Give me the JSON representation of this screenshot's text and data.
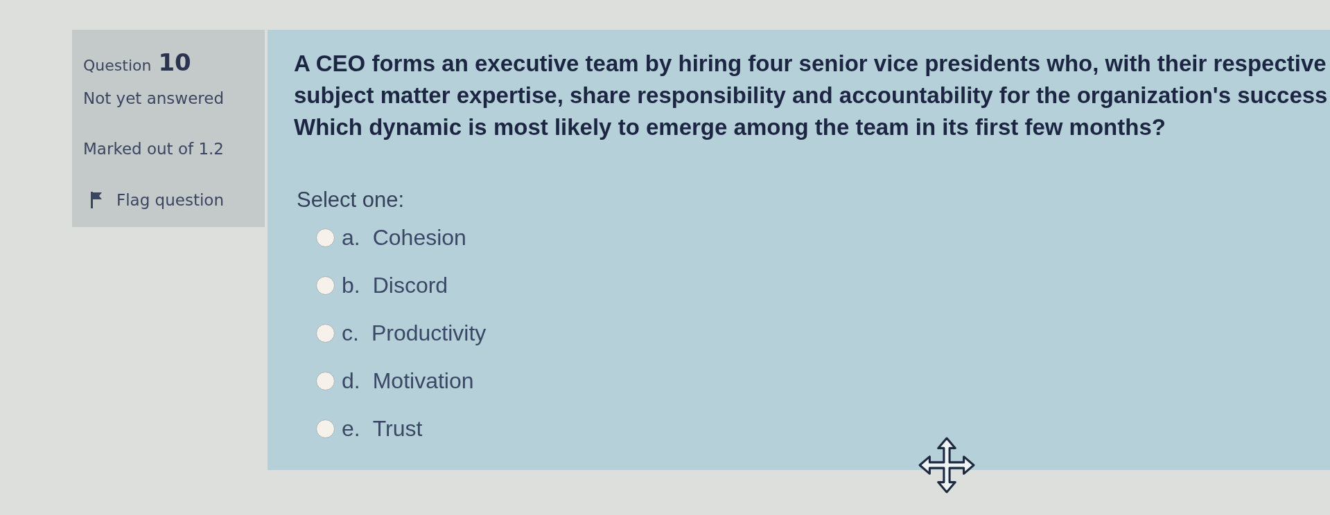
{
  "info": {
    "question_label": "Question",
    "question_number": "10",
    "status": "Not yet answered",
    "marks": "Marked out of 1.2",
    "flag_label": "Flag question"
  },
  "question": {
    "lines": [
      "A CEO forms an executive team by hiring four senior vice presidents who, with their respective",
      "subject matter expertise, share responsibility and accountability for the organization's success",
      "Which dynamic is most likely to emerge among the team in its first few months?"
    ],
    "prompt": "Select one:",
    "options": [
      {
        "letter": "a.",
        "text": "Cohesion",
        "selected": false
      },
      {
        "letter": "b.",
        "text": "Discord",
        "selected": false
      },
      {
        "letter": "c.",
        "text": "Productivity",
        "selected": false
      },
      {
        "letter": "d.",
        "text": "Motivation",
        "selected": false
      },
      {
        "letter": "e.",
        "text": "Trust",
        "selected": false
      }
    ]
  }
}
